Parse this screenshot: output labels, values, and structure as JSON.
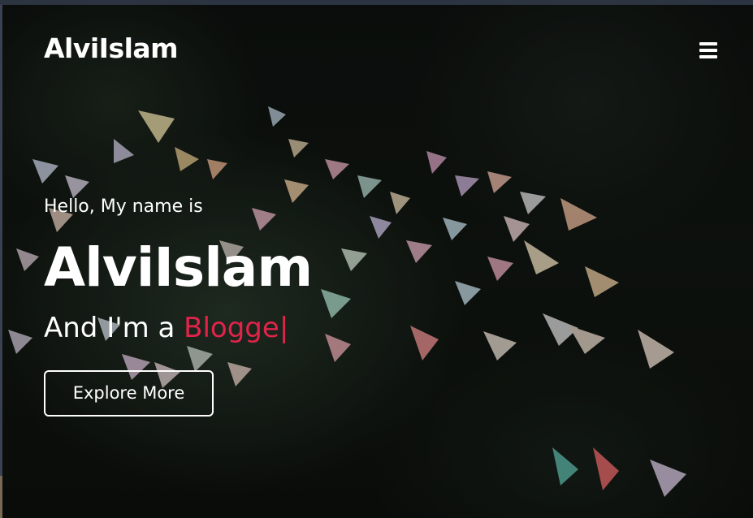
{
  "navbar": {
    "logo": "AlviIslam",
    "menu_icon": "hamburger-menu-icon"
  },
  "hero": {
    "greeting": "Hello, My name is",
    "name": "AlviIslam",
    "role_prefix": "And I'm a ",
    "role_word": "Blogge",
    "cursor": "|",
    "button_label": "Explore More"
  },
  "colors": {
    "accent": "#e2234a",
    "text": "#ffffff",
    "background": "#0d110e"
  }
}
